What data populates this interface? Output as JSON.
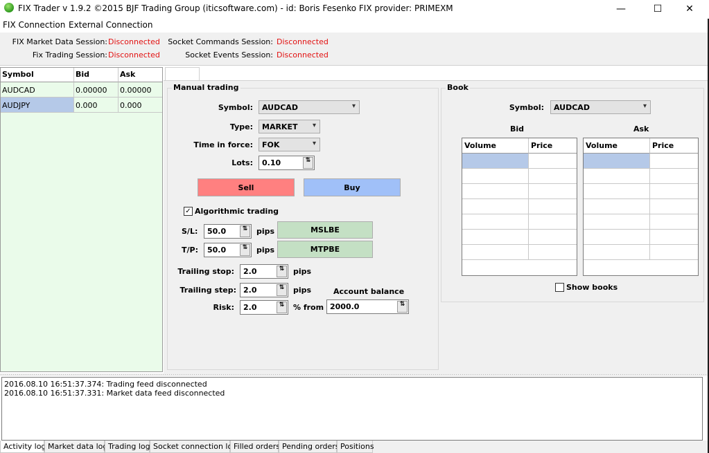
{
  "window": {
    "title": "FIX Trader v 1.9.2 ©2015 BJF Trading Group (iticsoftware.com) - id: Boris Fesenko FIX provider: PRIMEXM",
    "minimize": "—",
    "maximize": "☐",
    "close": "✕"
  },
  "menu": [
    "FIX Connection",
    "External Connection"
  ],
  "status": {
    "market_data_label": "FIX Market Data Session:",
    "market_data_value": "Disconnected",
    "trading_label": "Fix Trading Session:",
    "trading_value": "Disconnected",
    "socket_commands_label": "Socket Commands Session:",
    "socket_commands_value": "Disconnected",
    "socket_events_label": "Socket Events Session:",
    "socket_events_value": "Disconnected",
    "error_color": "#e21010"
  },
  "symbols": {
    "headers": [
      "Symbol",
      "Bid",
      "Ask"
    ],
    "rows": [
      [
        "AUDCAD",
        "0.00000",
        "0.00000"
      ],
      [
        "AUDJPY",
        "0.000",
        "0.000"
      ]
    ]
  },
  "manual": {
    "title": "Manual trading",
    "symbol_label": "Symbol:",
    "symbol_value": "AUDCAD",
    "type_label": "Type:",
    "type_value": "MARKET",
    "tif_label": "Time in force:",
    "tif_value": "FOK",
    "lots_label": "Lots:",
    "lots_value": "0.10",
    "sell_label": "Sell",
    "buy_label": "Buy",
    "sell_color": "#ff8080",
    "buy_color": "#a0c0f8",
    "algo_label": "Algorithmic trading",
    "algo_checked": "✓",
    "sl_label": "S/L:",
    "sl_value": "50.0",
    "tp_label": "T/P:",
    "tp_value": "50.0",
    "pips": "pips",
    "mslbe_label": "MSLBE",
    "mtpbe_label": "MTPBE",
    "trailing_stop_label": "Trailing stop:",
    "trailing_stop_value": "2.0",
    "trailing_step_label": "Trailing step:",
    "trailing_step_value": "2.0",
    "risk_label": "Risk:",
    "risk_value": "2.0",
    "pct_from": "% from",
    "balance_label": "Account balance",
    "balance_value": "2000.0",
    "spin_glyph": "⇅"
  },
  "book": {
    "title": "Book",
    "symbol_label": "Symbol:",
    "symbol_value": "AUDCAD",
    "bid_label": "Bid",
    "ask_label": "Ask",
    "col_volume": "Volume",
    "col_price": "Price",
    "show_books_label": "Show books"
  },
  "log": {
    "lines": [
      "2016.08.10 16:51:37.374: Trading feed disconnected",
      "2016.08.10 16:51:37.331: Market data feed disconnected"
    ]
  },
  "bottom_tabs": [
    "Activity log",
    "Market data log",
    "Trading log",
    "Socket connection log",
    "Filled orders",
    "Pending orders",
    "Positions"
  ],
  "icons": {
    "app": "app-logo-icon",
    "chevron": "▾"
  }
}
